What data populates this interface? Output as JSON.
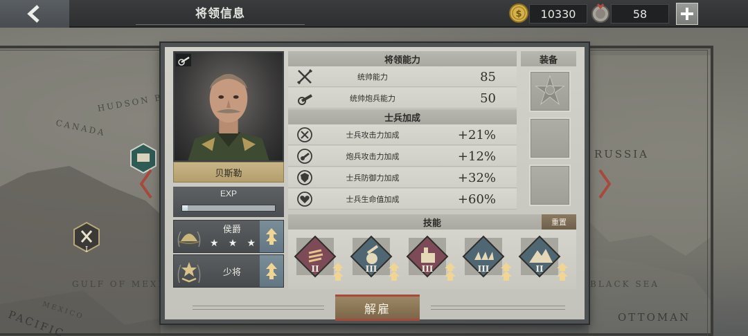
{
  "topbar": {
    "title": "将领信息",
    "gold": "10330",
    "medals": "58"
  },
  "map": {
    "labels": [
      "HUDSON BAY",
      "CANADA",
      "RUSSIA",
      "GULF OF MEXICO",
      "MEXICO",
      "PACIFIC",
      "BLACK SEA",
      "OTTOMAN"
    ],
    "unit_level": "I"
  },
  "general": {
    "name": "贝斯勒",
    "exp_label": "EXP",
    "exp_fraction": 0.06,
    "title_rank": "侯爵",
    "title_stars": 3,
    "military_rank": "少将"
  },
  "abilities": {
    "header": "将领能力",
    "rows": [
      {
        "icon": "crossed-swords-icon",
        "name": "统帅能力",
        "value": "85"
      },
      {
        "icon": "cannon-icon",
        "name": "统帅炮兵能力",
        "value": "50"
      }
    ]
  },
  "soldier_bonus": {
    "header": "士兵加成",
    "rows": [
      {
        "icon": "sword-circle-icon",
        "name": "士兵攻击力加成",
        "value": "+21%"
      },
      {
        "icon": "artillery-circle-icon",
        "name": "炮兵攻击力加成",
        "value": "+12%"
      },
      {
        "icon": "shield-circle-icon",
        "name": "士兵防御力加成",
        "value": "+32%"
      },
      {
        "icon": "heart-circle-icon",
        "name": "士兵生命值加成",
        "value": "+60%"
      }
    ]
  },
  "equipment": {
    "header": "装备",
    "slots": [
      "star-medal-icon",
      "empty",
      "empty"
    ]
  },
  "skills": {
    "header": "技能",
    "reset_label": "重置",
    "items": [
      {
        "icon": "rifle-volley-icon",
        "level": "II",
        "color": "#7d4b57"
      },
      {
        "icon": "grenade-icon",
        "level": "III",
        "color": "#4f6673"
      },
      {
        "icon": "fortress-icon",
        "level": "III",
        "color": "#7d4b57"
      },
      {
        "icon": "barricade-icon",
        "level": "III",
        "color": "#4f6673"
      },
      {
        "icon": "mountain-icon",
        "level": "II",
        "color": "#4f6673"
      }
    ]
  },
  "actions": {
    "dismiss_label": "解雇"
  },
  "colors": {
    "accent_red": "#a8493d",
    "gold_plate": "#c8b588",
    "panel_bg": "#c9c8c1"
  }
}
